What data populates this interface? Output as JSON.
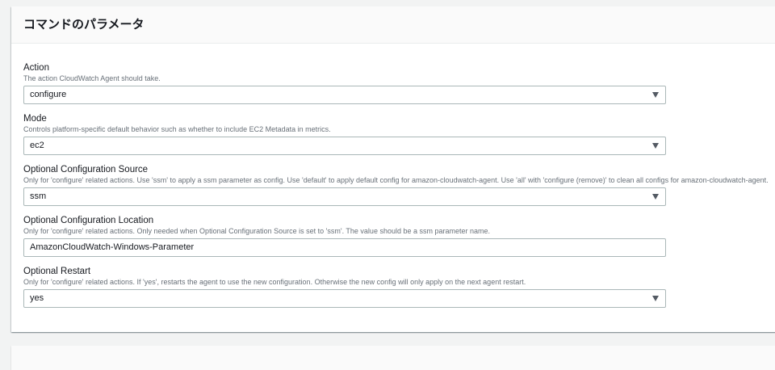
{
  "section_title": "コマンドのパラメータ",
  "fields": [
    {
      "label": "Action",
      "description": "The action CloudWatch Agent should take.",
      "value": "configure"
    },
    {
      "label": "Mode",
      "description": "Controls platform-specific default behavior such as whether to include EC2 Metadata in metrics.",
      "value": "ec2"
    },
    {
      "label": "Optional Configuration Source",
      "description": "Only for 'configure' related actions. Use 'ssm' to apply a ssm parameter as config. Use 'default' to apply default config for amazon-cloudwatch-agent. Use 'all' with 'configure (remove)' to clean all configs for amazon-cloudwatch-agent.",
      "value": "ssm"
    },
    {
      "label": "Optional Configuration Location",
      "description": "Only for 'configure' related actions. Only needed when Optional Configuration Source is set to 'ssm'. The value should be a ssm parameter name.",
      "value": "AmazonCloudWatch-Windows-Parameter"
    },
    {
      "label": "Optional Restart",
      "description": "Only for 'configure' related actions. If 'yes', restarts the agent to use the new configuration. Otherwise the new config will only apply on the next agent restart.",
      "value": "yes"
    }
  ]
}
